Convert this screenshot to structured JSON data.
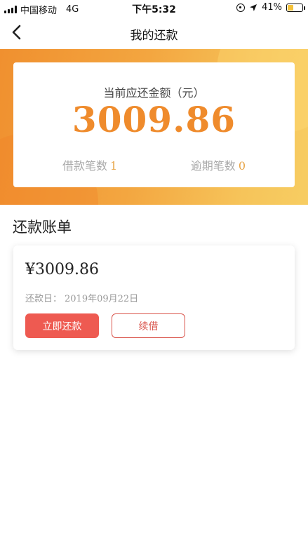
{
  "status_bar": {
    "carrier": "中国移动",
    "network": "4G",
    "time": "下午5:32",
    "battery": "41%",
    "battery_level": 0.41,
    "icons": [
      "signal-icon",
      "orientation-lock-icon",
      "location-icon",
      "battery-icon"
    ]
  },
  "nav": {
    "title": "我的还款",
    "back_icon": "chevron-left-icon"
  },
  "summary": {
    "label": "当前应还金额（元）",
    "amount": "3009.86",
    "loans_label": "借款笔数",
    "loans_count": "1",
    "overdue_label": "逾期笔数",
    "overdue_count": "0"
  },
  "bills": {
    "section_title": "还款账单",
    "items": [
      {
        "amount": "¥3009.86",
        "date_label": "还款日：",
        "date": "2019年09月22日",
        "repay_label": "立即还款",
        "renew_label": "续借"
      }
    ]
  },
  "colors": {
    "accent_orange": "#ef8b2c",
    "repay_red": "#ee5a51",
    "count_gold": "#e8a548"
  }
}
